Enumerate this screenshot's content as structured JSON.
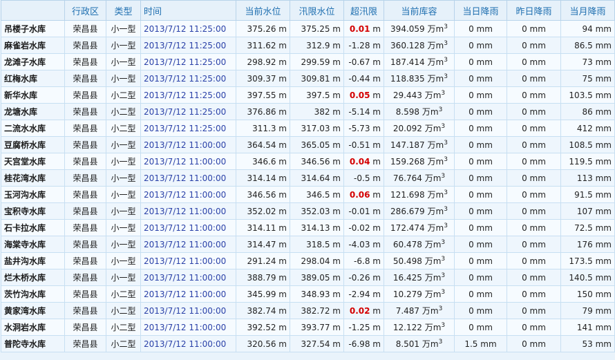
{
  "headers": [
    "",
    "行政区",
    "类型",
    "时间",
    "当前水位",
    "汛限水位",
    "超汛限",
    "当前库容",
    "当日降雨",
    "昨日降雨",
    "当月降雨"
  ],
  "units": {
    "level": "m",
    "capacity": "万m",
    "capacity_sup": "3",
    "rain": "mm"
  },
  "colors": {
    "header_text": "#1f6fb0",
    "time_text": "#2a41a8",
    "over_positive": "#d40000",
    "border": "#c7dff2"
  },
  "rows": [
    {
      "name": "吊楼子水库",
      "region": "荣昌县",
      "type": "小一型",
      "time": "2013/7/12 11:25:00",
      "level": "375.26",
      "flood_limit": "375.25",
      "over": "0.01",
      "capacity": "394.059",
      "rain_today": "0",
      "rain_yesterday": "0",
      "rain_month": "94"
    },
    {
      "name": "麻雀岩水库",
      "region": "荣昌县",
      "type": "小一型",
      "time": "2013/7/12 11:25:00",
      "level": "311.62",
      "flood_limit": "312.9",
      "over": "-1.28",
      "capacity": "360.128",
      "rain_today": "0",
      "rain_yesterday": "0",
      "rain_month": "86.5"
    },
    {
      "name": "龙滩子水库",
      "region": "荣昌县",
      "type": "小一型",
      "time": "2013/7/12 11:25:00",
      "level": "298.92",
      "flood_limit": "299.59",
      "over": "-0.67",
      "capacity": "187.414",
      "rain_today": "0",
      "rain_yesterday": "0",
      "rain_month": "73"
    },
    {
      "name": "红梅水库",
      "region": "荣昌县",
      "type": "小一型",
      "time": "2013/7/12 11:25:00",
      "level": "309.37",
      "flood_limit": "309.81",
      "over": "-0.44",
      "capacity": "118.835",
      "rain_today": "0",
      "rain_yesterday": "0",
      "rain_month": "75"
    },
    {
      "name": "新华水库",
      "region": "荣昌县",
      "type": "小二型",
      "time": "2013/7/12 11:25:00",
      "level": "397.55",
      "flood_limit": "397.5",
      "over": "0.05",
      "capacity": "29.443",
      "rain_today": "0",
      "rain_yesterday": "0",
      "rain_month": "103.5"
    },
    {
      "name": "龙塘水库",
      "region": "荣昌县",
      "type": "小二型",
      "time": "2013/7/12 11:25:00",
      "level": "376.86",
      "flood_limit": "382",
      "over": "-5.14",
      "capacity": "8.598",
      "rain_today": "0",
      "rain_yesterday": "0",
      "rain_month": "86"
    },
    {
      "name": "二流水水库",
      "region": "荣昌县",
      "type": "小二型",
      "time": "2013/7/12 11:25:00",
      "level": "311.3",
      "flood_limit": "317.03",
      "over": "-5.73",
      "capacity": "20.092",
      "rain_today": "0",
      "rain_yesterday": "0",
      "rain_month": "412"
    },
    {
      "name": "豆腐桥水库",
      "region": "荣昌县",
      "type": "小一型",
      "time": "2013/7/12 11:00:00",
      "level": "364.54",
      "flood_limit": "365.05",
      "over": "-0.51",
      "capacity": "147.187",
      "rain_today": "0",
      "rain_yesterday": "0",
      "rain_month": "108.5"
    },
    {
      "name": "天宫堂水库",
      "region": "荣昌县",
      "type": "小一型",
      "time": "2013/7/12 11:00:00",
      "level": "346.6",
      "flood_limit": "346.56",
      "over": "0.04",
      "capacity": "159.268",
      "rain_today": "0",
      "rain_yesterday": "0",
      "rain_month": "119.5"
    },
    {
      "name": "桂花湾水库",
      "region": "荣昌县",
      "type": "小一型",
      "time": "2013/7/12 11:00:00",
      "level": "314.14",
      "flood_limit": "314.64",
      "over": "-0.5",
      "capacity": "76.764",
      "rain_today": "0",
      "rain_yesterday": "0",
      "rain_month": "113"
    },
    {
      "name": "玉河沟水库",
      "region": "荣昌县",
      "type": "小一型",
      "time": "2013/7/12 11:00:00",
      "level": "346.56",
      "flood_limit": "346.5",
      "over": "0.06",
      "capacity": "121.698",
      "rain_today": "0",
      "rain_yesterday": "0",
      "rain_month": "91.5"
    },
    {
      "name": "宝积寺水库",
      "region": "荣昌县",
      "type": "小一型",
      "time": "2013/7/12 11:00:00",
      "level": "352.02",
      "flood_limit": "352.03",
      "over": "-0.01",
      "capacity": "286.679",
      "rain_today": "0",
      "rain_yesterday": "0",
      "rain_month": "107"
    },
    {
      "name": "石卡拉水库",
      "region": "荣昌县",
      "type": "小一型",
      "time": "2013/7/12 11:00:00",
      "level": "314.11",
      "flood_limit": "314.13",
      "over": "-0.02",
      "capacity": "172.474",
      "rain_today": "0",
      "rain_yesterday": "0",
      "rain_month": "72.5"
    },
    {
      "name": "海棠寺水库",
      "region": "荣昌县",
      "type": "小一型",
      "time": "2013/7/12 11:00:00",
      "level": "314.47",
      "flood_limit": "318.5",
      "over": "-4.03",
      "capacity": "60.478",
      "rain_today": "0",
      "rain_yesterday": "0",
      "rain_month": "176"
    },
    {
      "name": "盐井沟水库",
      "region": "荣昌县",
      "type": "小一型",
      "time": "2013/7/12 11:00:00",
      "level": "291.24",
      "flood_limit": "298.04",
      "over": "-6.8",
      "capacity": "50.498",
      "rain_today": "0",
      "rain_yesterday": "0",
      "rain_month": "173.5"
    },
    {
      "name": "烂木桥水库",
      "region": "荣昌县",
      "type": "小一型",
      "time": "2013/7/12 11:00:00",
      "level": "388.79",
      "flood_limit": "389.05",
      "over": "-0.26",
      "capacity": "16.425",
      "rain_today": "0",
      "rain_yesterday": "0",
      "rain_month": "140.5"
    },
    {
      "name": "茨竹沟水库",
      "region": "荣昌县",
      "type": "小二型",
      "time": "2013/7/12 11:00:00",
      "level": "345.99",
      "flood_limit": "348.93",
      "over": "-2.94",
      "capacity": "10.279",
      "rain_today": "0",
      "rain_yesterday": "0",
      "rain_month": "150"
    },
    {
      "name": "黄家湾水库",
      "region": "荣昌县",
      "type": "小二型",
      "time": "2013/7/12 11:00:00",
      "level": "382.74",
      "flood_limit": "382.72",
      "over": "0.02",
      "capacity": "7.487",
      "rain_today": "0",
      "rain_yesterday": "0",
      "rain_month": "79"
    },
    {
      "name": "水洞岩水库",
      "region": "荣昌县",
      "type": "小二型",
      "time": "2013/7/12 11:00:00",
      "level": "392.52",
      "flood_limit": "393.77",
      "over": "-1.25",
      "capacity": "12.122",
      "rain_today": "0",
      "rain_yesterday": "0",
      "rain_month": "141"
    },
    {
      "name": "普陀寺水库",
      "region": "荣昌县",
      "type": "小二型",
      "time": "2013/7/12 11:00:00",
      "level": "320.56",
      "flood_limit": "327.54",
      "over": "-6.98",
      "capacity": "8.501",
      "rain_today": "1.5",
      "rain_yesterday": "0",
      "rain_month": "53"
    }
  ]
}
